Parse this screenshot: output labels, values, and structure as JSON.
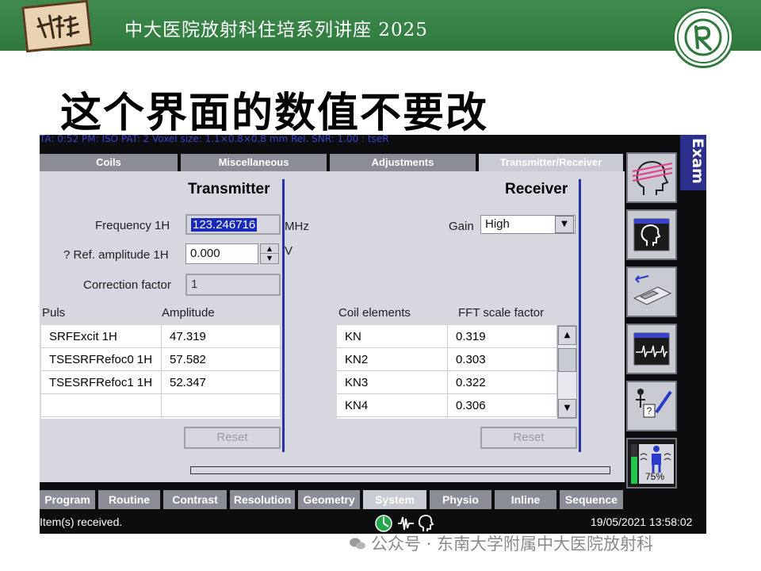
{
  "banner": {
    "title": "中大医院放射科住培系列讲座 2025",
    "left_logo_text": "住培",
    "accent": "#2f7a3d"
  },
  "slide": {
    "heading": "这个界面的数值不要改"
  },
  "screen": {
    "top_strip": "TA: 0:52    PM: ISO    PAT: 2    Voxel size: 1.1×0.8×0.8 mm   Rel. SNR: 1.00    : tseR",
    "exam_label": "Exam",
    "tabs": [
      {
        "label": "Coils",
        "active": false
      },
      {
        "label": "Miscellaneous",
        "active": false
      },
      {
        "label": "Adjustments",
        "active": false
      },
      {
        "label": "Transmitter/Receiver",
        "active": true
      }
    ],
    "transmitter": {
      "title": "Transmitter",
      "frequency_label": "Frequency 1H",
      "frequency_value": "123.246716",
      "frequency_unit": "MHz",
      "ref_amp_label": "? Ref. amplitude 1H",
      "ref_amp_value": "0.000",
      "ref_amp_unit": "V",
      "correction_label": "Correction factor",
      "correction_value": "1",
      "col_puls": "Puls",
      "col_amplitude": "Amplitude",
      "rows": [
        {
          "puls": "SRFExcit 1H",
          "amplitude": "47.319"
        },
        {
          "puls": "TSESRFRefoc0 1H",
          "amplitude": "57.582"
        },
        {
          "puls": "TSESRFRefoc1 1H",
          "amplitude": "52.347"
        },
        {
          "puls": "",
          "amplitude": ""
        }
      ],
      "reset_label": "Reset"
    },
    "receiver": {
      "title": "Receiver",
      "gain_label": "Gain",
      "gain_value": "High",
      "col_coil": "Coil elements",
      "col_fft": "FFT scale factor",
      "rows": [
        {
          "coil": "KN",
          "fft": "0.319"
        },
        {
          "coil": "KN2",
          "fft": "0.303"
        },
        {
          "coil": "KN3",
          "fft": "0.322"
        },
        {
          "coil": "KN4",
          "fft": "0.306"
        }
      ],
      "reset_label": "Reset"
    },
    "bottom_tabs": [
      {
        "label": "Program",
        "active": false
      },
      {
        "label": "Routine",
        "active": false
      },
      {
        "label": "Contrast",
        "active": false
      },
      {
        "label": "Resolution",
        "active": false
      },
      {
        "label": "Geometry",
        "active": false
      },
      {
        "label": "System",
        "active": true
      },
      {
        "label": "Physio",
        "active": false
      },
      {
        "label": "Inline",
        "active": false
      },
      {
        "label": "Sequence",
        "active": false
      }
    ],
    "side_icons": [
      {
        "name": "head-slices-icon"
      },
      {
        "name": "head-window-icon"
      },
      {
        "name": "table-move-icon"
      },
      {
        "name": "waveform-window-icon"
      },
      {
        "name": "help-pen-icon"
      },
      {
        "name": "patient-level-icon",
        "label": "75%"
      }
    ],
    "status": {
      "message": "Item(s) received.",
      "datetime": "19/05/2021 13:58:02"
    }
  },
  "watermark": "公众号 · 东南大学附属中大医院放射科"
}
